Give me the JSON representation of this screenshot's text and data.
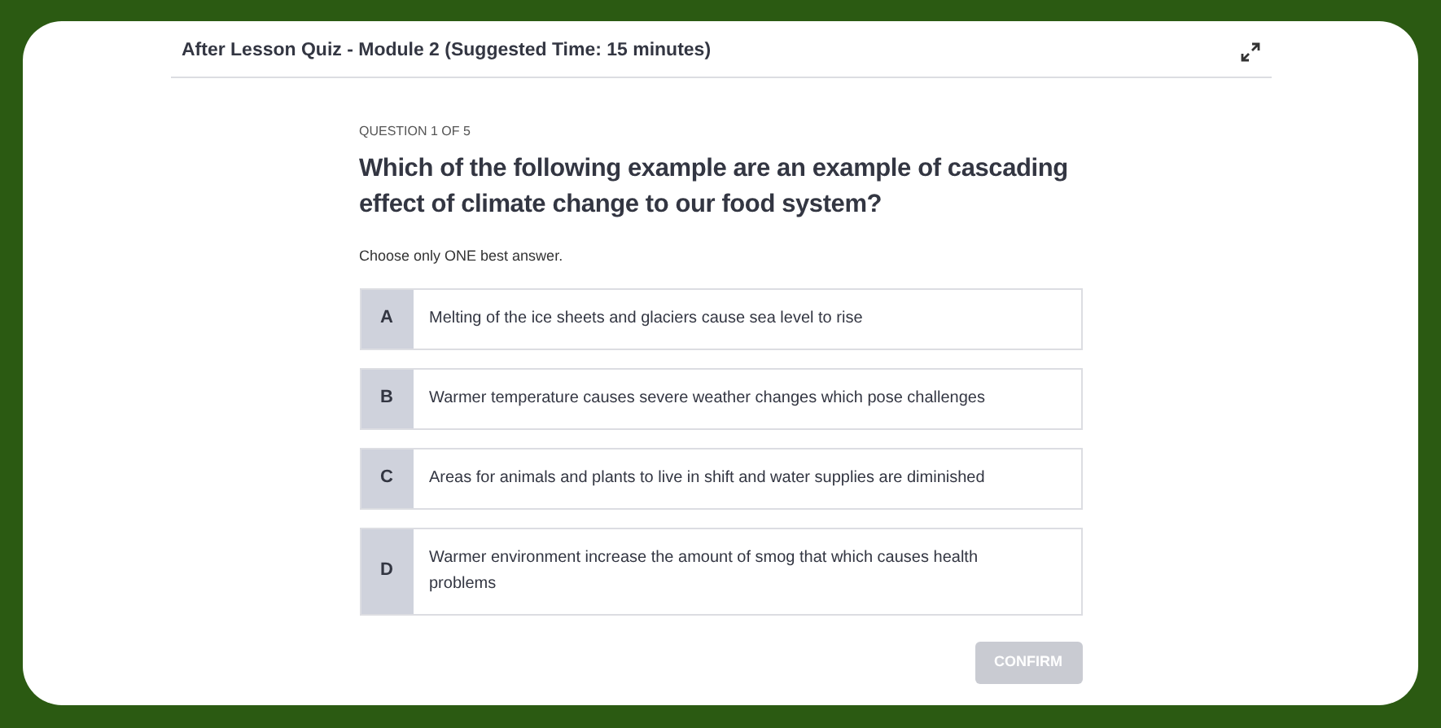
{
  "header": {
    "title": "After Lesson Quiz - Module 2 (Suggested Time: 15 minutes)"
  },
  "question": {
    "counter": "QUESTION 1 OF 5",
    "text": "Which of the following example are an example of cascading effect of climate change to our food system?",
    "instruction": "Choose only ONE best answer."
  },
  "options": [
    {
      "letter": "A",
      "text": "Melting of the ice sheets and glaciers cause sea level to rise",
      "selected": false
    },
    {
      "letter": "B",
      "text": "Warmer temperature causes severe weather changes which pose challenges",
      "selected": false
    },
    {
      "letter": "C",
      "text": "Areas for animals and plants to live in shift and water supplies are diminished",
      "selected": false
    },
    {
      "letter": "D",
      "text": "Warmer environment increase the amount of smog that which causes health problems",
      "selected": false
    }
  ],
  "confirm_button": {
    "label": "CONFIRM",
    "disabled": true
  }
}
